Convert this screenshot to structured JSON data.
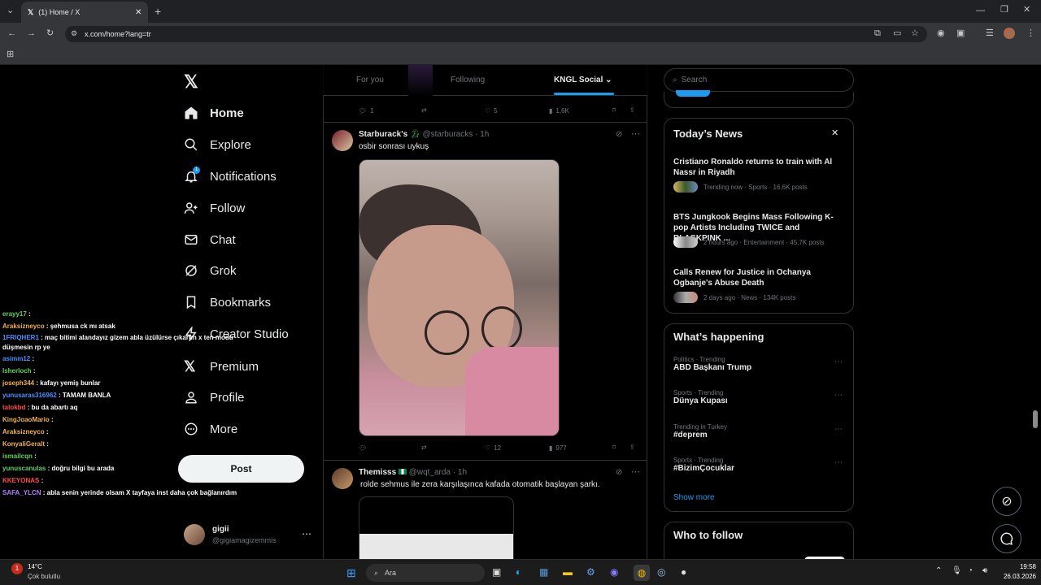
{
  "browser": {
    "tab_title": "(1) Home / X",
    "url": "x.com/home?lang=tr"
  },
  "nav": {
    "items": [
      {
        "label": "Home",
        "icon": "home-icon"
      },
      {
        "label": "Explore",
        "icon": "search-icon"
      },
      {
        "label": "Notifications",
        "icon": "bell-icon",
        "badge": "1"
      },
      {
        "label": "Follow",
        "icon": "person-add-icon"
      },
      {
        "label": "Chat",
        "icon": "mail-icon"
      },
      {
        "label": "Grok",
        "icon": "grok-icon"
      },
      {
        "label": "Bookmarks",
        "icon": "bookmark-icon"
      },
      {
        "label": "Creator Studio",
        "icon": "lightning-icon"
      },
      {
        "label": "Premium",
        "icon": "x-logo-icon"
      },
      {
        "label": "Profile",
        "icon": "person-icon"
      },
      {
        "label": "More",
        "icon": "more-circle-icon"
      }
    ],
    "post_label": "Post",
    "account": {
      "name": "gigii",
      "handle": "@gigiamagizemmis"
    }
  },
  "feed": {
    "tabs": [
      "For you",
      "Following",
      "KNGL Social"
    ],
    "active_tab": "KNGL Social",
    "prev_post": {
      "replies": "1",
      "likes": "5",
      "views": "1,6K"
    },
    "post1": {
      "name": "Starburack's",
      "handle": "@starburacks",
      "time": "1h",
      "text": "osbir sonrası uykuş",
      "likes": "12",
      "views": "977"
    },
    "post2": {
      "name": "Themisss",
      "handle": "@wqt_arda",
      "time": "1h",
      "text": "rolde sehmus ile zera karşılaşınca kafada otomatik başlayan şarkı."
    }
  },
  "right": {
    "search_placeholder": "Search",
    "news_title": "Today’s News",
    "news": [
      {
        "title": "Cristiano Ronaldo returns to train with Al Nassr in Riyadh",
        "meta": "Trending now · Sports · 16,6K posts"
      },
      {
        "title": "BTS Jungkook Begins Mass Following K-pop Artists Including TWICE and BLACKPINK ...",
        "meta": "2 hours ago · Entertainment · 45,7K posts"
      },
      {
        "title": "Calls Renew for Justice in Ochanya Ogbanje's Abuse Death",
        "meta": "2 days ago · News · 134K posts"
      }
    ],
    "happening_title": "What’s happening",
    "trends": [
      {
        "cat": "Politics · Trending",
        "name": "ABD Başkanı Trump"
      },
      {
        "cat": "Sports · Trending",
        "name": "Dünya Kupası"
      },
      {
        "cat": "Trending in Turkey",
        "name": "#deprem"
      },
      {
        "cat": "Sports · Trending",
        "name": "#BizimÇocuklar"
      }
    ],
    "show_more": "Show more",
    "who_to_follow": "Who to follow"
  },
  "chat": [
    {
      "user": "erayy17",
      "msg": ":",
      "color": "#5fd35f"
    },
    {
      "user": "Araksizneyco",
      "msg": ": şehmusa ck mı atsak",
      "color": "#f0b24a"
    },
    {
      "user": "1FRIQHER1",
      "msg": ": maç bitimi alandayız gizem abla üzülürse çıkartın x ten modu",
      "color": "#4a90ff"
    },
    {
      "user": "",
      "msg": "düşmesin rp ye",
      "color": "#fff"
    },
    {
      "user": "asimm12",
      "msg": ":",
      "color": "#4a90ff"
    },
    {
      "user": "Isherloch",
      "msg": ":",
      "color": "#5fd35f"
    },
    {
      "user": "joseph344",
      "msg": ": kafayı yemiş bunlar",
      "color": "#f0b24a"
    },
    {
      "user": "yunusaras316962",
      "msg": ": TAMAM BANLA",
      "color": "#4a90ff"
    },
    {
      "user": "talokbd",
      "msg": ": bu da abartı aq",
      "color": "#ff4a4a"
    },
    {
      "user": "KingJoaoMario",
      "msg": ":",
      "color": "#f0b24a"
    },
    {
      "user": "Araksizneyco",
      "msg": ":",
      "color": "#f0b24a"
    },
    {
      "user": "KonyaliGeralt",
      "msg": ":",
      "color": "#f0b24a"
    },
    {
      "user": "ismailcqn",
      "msg": ":",
      "color": "#5fd35f"
    },
    {
      "user": "yunuscanulas",
      "msg": ": doğru bilgi bu arada",
      "color": "#5fd35f"
    },
    {
      "user": "KKEYONAS",
      "msg": ":",
      "color": "#ff4a4a"
    },
    {
      "user": "SAFA_YLCN",
      "msg": ": abla senin yerinde olsam X tayfaya inst daha çok bağlanırdım",
      "color": "#b57cff"
    }
  ],
  "taskbar": {
    "weather_temp": "14°C",
    "weather_desc": "Çok bulutlu",
    "search_label": "Ara",
    "time": "19:58",
    "date": "26.03.2026"
  }
}
